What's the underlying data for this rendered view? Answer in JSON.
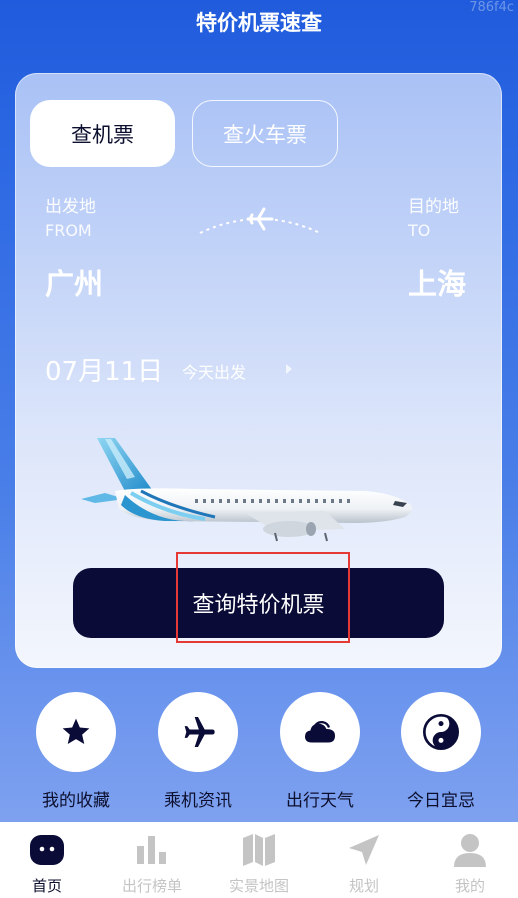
{
  "watermark": "786f4c",
  "header": {
    "title": "特价机票速查"
  },
  "tabs": [
    {
      "label": "查机票",
      "active": true
    },
    {
      "label": "查火车票",
      "active": false
    }
  ],
  "route": {
    "from_label": "出发地",
    "from_sub": "FROM",
    "to_label": "目的地",
    "to_sub": "TO",
    "from_city": "广州",
    "to_city": "上海"
  },
  "date": {
    "value": "07月11日",
    "note": "今天出发"
  },
  "search_button": {
    "label": "查询特价机票"
  },
  "quick_links": [
    {
      "label": "我的收藏",
      "icon": "star-icon"
    },
    {
      "label": "乘机资讯",
      "icon": "airplane-icon"
    },
    {
      "label": "出行天气",
      "icon": "cloud-icon"
    },
    {
      "label": "今日宜忌",
      "icon": "yin-yang-icon"
    }
  ],
  "tabbar": [
    {
      "label": "首页",
      "icon": "home-icon",
      "active": true
    },
    {
      "label": "出行榜单",
      "icon": "bar-chart-icon",
      "active": false
    },
    {
      "label": "实景地图",
      "icon": "map-icon",
      "active": false
    },
    {
      "label": "规划",
      "icon": "navigation-icon",
      "active": false
    },
    {
      "label": "我的",
      "icon": "user-icon",
      "active": false
    }
  ],
  "colors": {
    "primary_dark": "#0a0b36",
    "background_blue": "#2f6ae4",
    "highlight_red": "#e53935",
    "inactive_gray": "#c4c4c4"
  }
}
